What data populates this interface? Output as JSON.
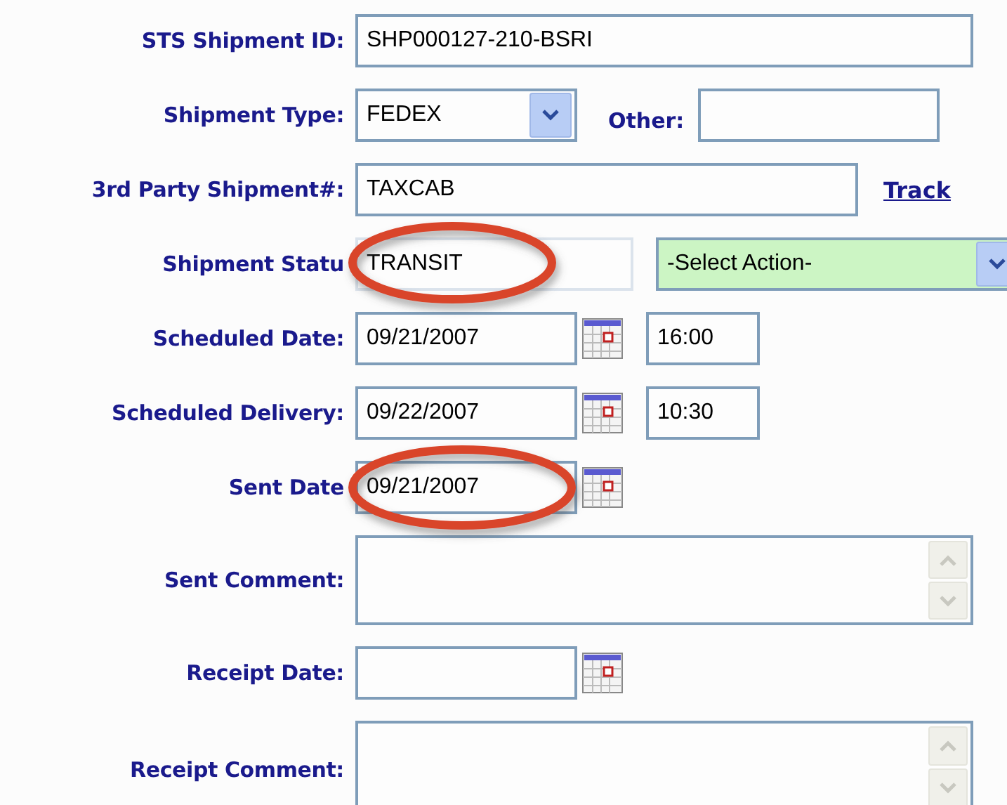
{
  "rows": [
    {
      "kind": "text",
      "label": "STS Shipment ID:",
      "value": "SHP000127-210-BSRI",
      "circled": false
    },
    {
      "kind": "select-other",
      "label": "Shipment Type:",
      "value": "FEDEX",
      "other_label": "Other:",
      "other_value": "",
      "circled": false
    },
    {
      "kind": "text-link",
      "label": "3rd Party Shipment#:",
      "value": "TAXCAB",
      "link": "Track",
      "circled": false
    },
    {
      "kind": "status",
      "label": "Shipment Statu",
      "value": "TRANSIT",
      "action": "-Select Action-",
      "circled": true
    },
    {
      "kind": "datetime",
      "label": "Scheduled Date:",
      "value": "09/21/2007",
      "time": "16:00",
      "circled": false
    },
    {
      "kind": "datetime",
      "label": "Scheduled Delivery:",
      "value": "09/22/2007",
      "time": "10:30",
      "circled": false
    },
    {
      "kind": "date",
      "label": "Sent Date",
      "value": "09/21/2007",
      "circled": true
    },
    {
      "kind": "textarea",
      "label": "Sent Comment:",
      "value": "",
      "circled": false
    },
    {
      "kind": "date",
      "label": "Receipt Date:",
      "value": "",
      "circled": false
    },
    {
      "kind": "textarea",
      "label": "Receipt Comment:",
      "value": "",
      "circled": false
    }
  ]
}
